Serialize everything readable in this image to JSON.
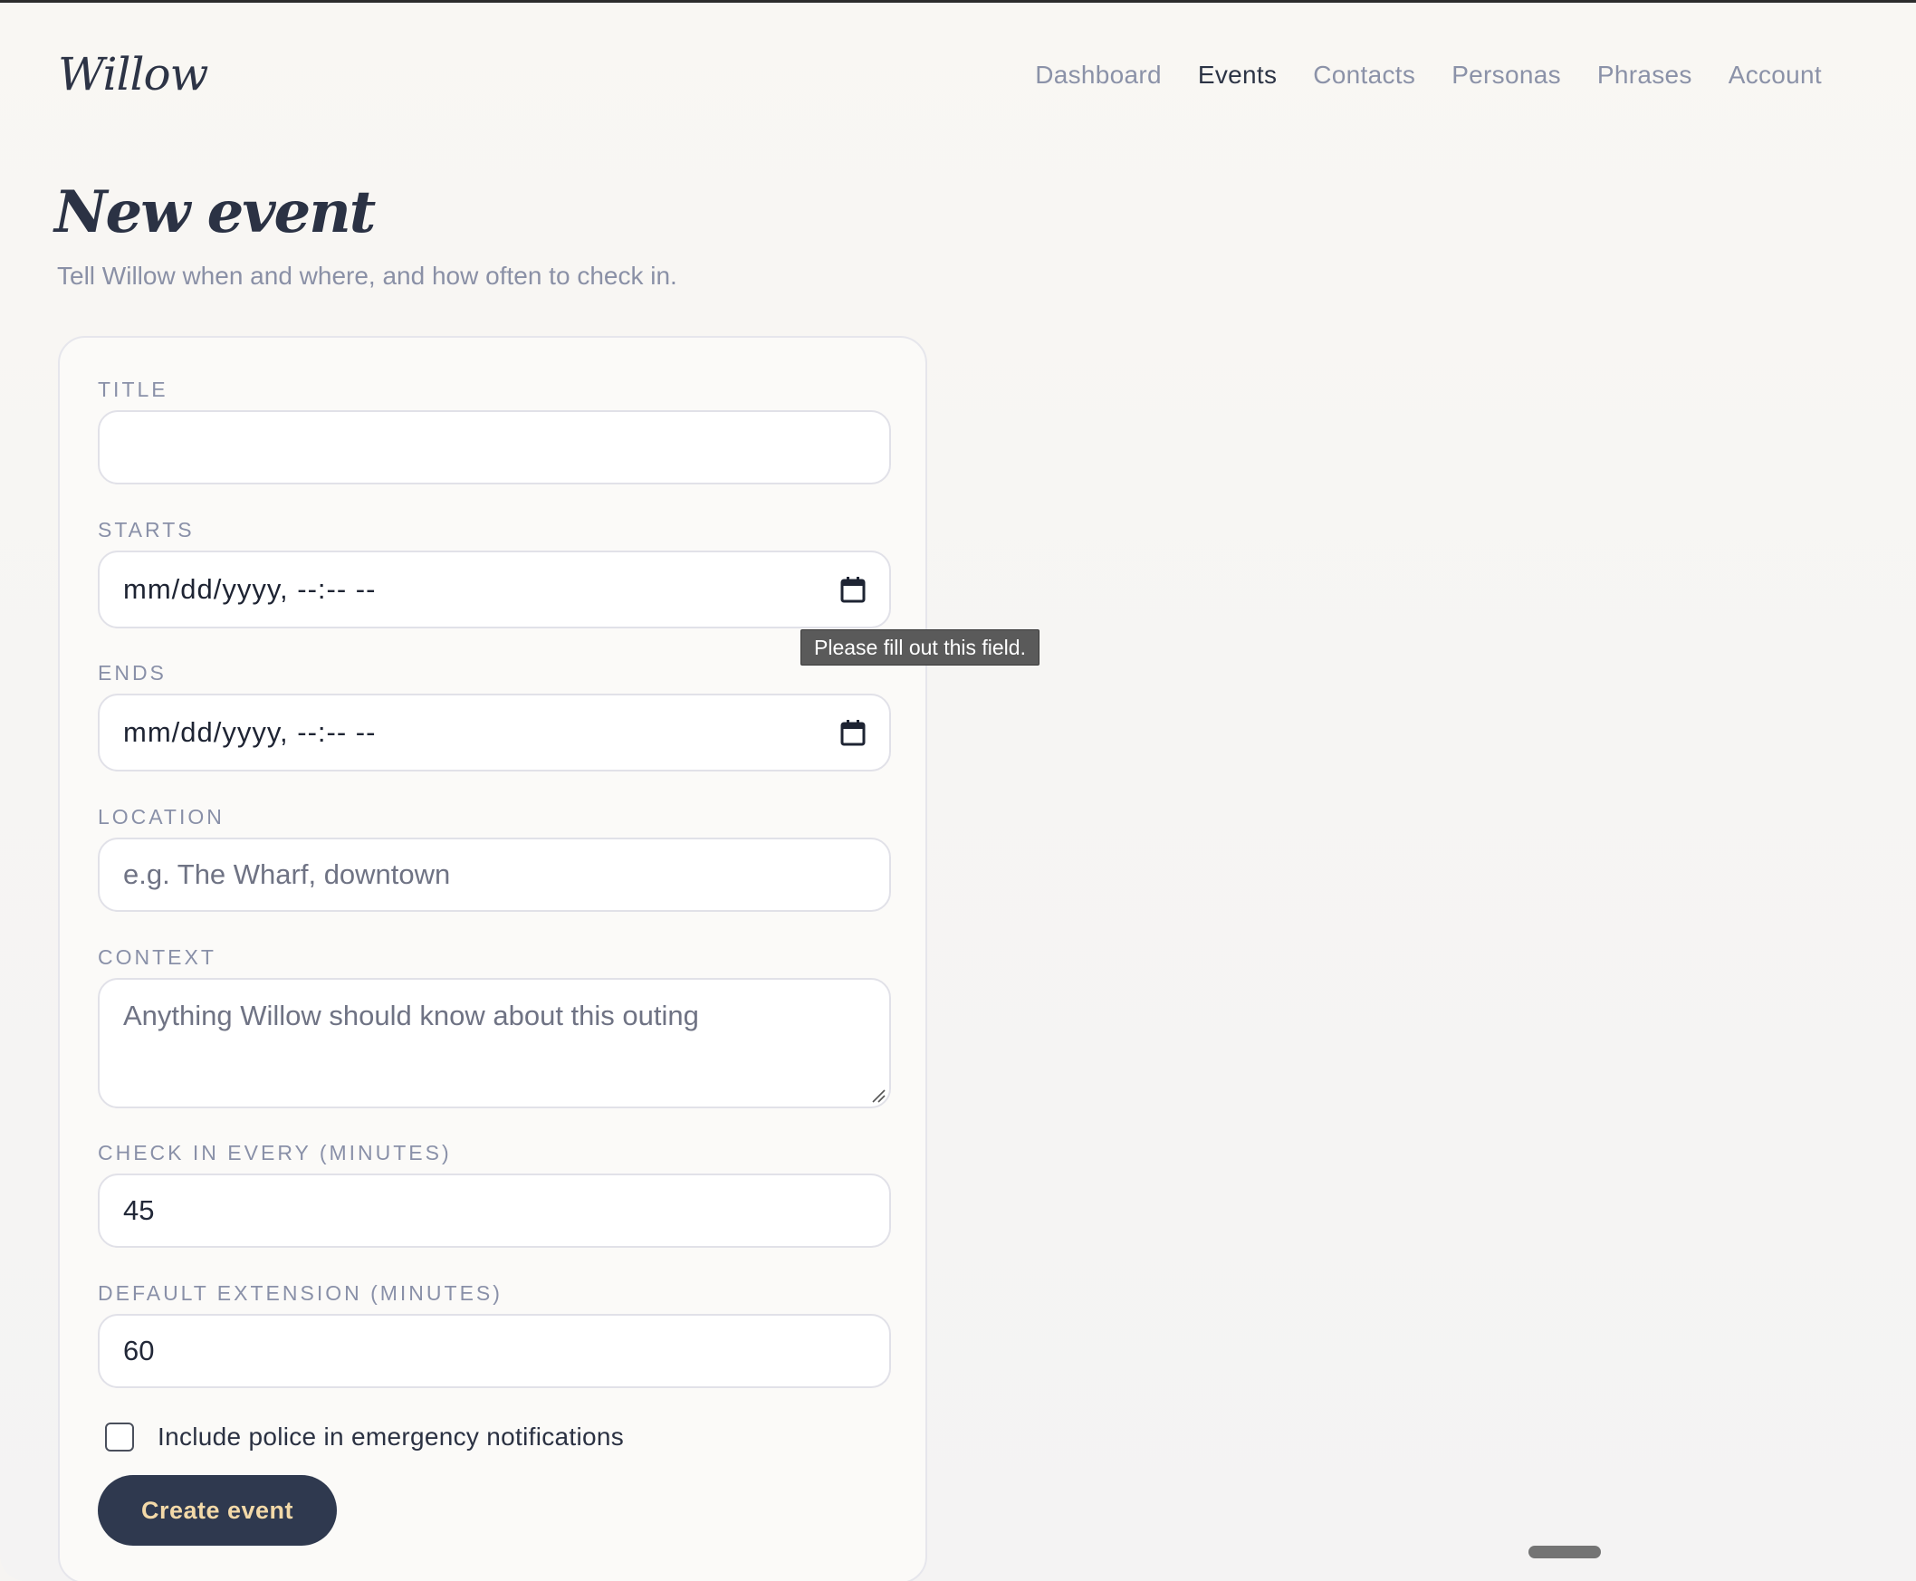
{
  "header": {
    "logo": "Willow",
    "nav": [
      {
        "label": "Dashboard",
        "active": false
      },
      {
        "label": "Events",
        "active": true
      },
      {
        "label": "Contacts",
        "active": false
      },
      {
        "label": "Personas",
        "active": false
      },
      {
        "label": "Phrases",
        "active": false
      },
      {
        "label": "Account",
        "active": false
      }
    ]
  },
  "page": {
    "title": "New event",
    "subtitle": "Tell Willow when and where, and how often to check in."
  },
  "form": {
    "title": {
      "label": "TITLE",
      "value": ""
    },
    "starts": {
      "label": "STARTS",
      "value": "mm/dd/yyyy, --:-- --",
      "icon": "calendar-icon"
    },
    "ends": {
      "label": "ENDS",
      "value": "mm/dd/yyyy, --:-- --",
      "icon": "calendar-icon"
    },
    "location": {
      "label": "LOCATION",
      "placeholder": "e.g. The Wharf, downtown"
    },
    "context": {
      "label": "CONTEXT",
      "placeholder": "Anything Willow should know about this outing"
    },
    "check_in": {
      "label": "CHECK IN EVERY (MINUTES)",
      "value": "45"
    },
    "extension": {
      "label": "DEFAULT EXTENSION (MINUTES)",
      "value": "60"
    },
    "police": {
      "label": "Include police in emergency notifications",
      "checked": false
    },
    "submit_label": "Create event"
  },
  "tooltip": {
    "text": "Please fill out this field."
  },
  "colors": {
    "primary_button": "#2f394f",
    "button_text": "#f3d9a8",
    "nav_inactive": "#8b92a8",
    "nav_active": "#2c3445"
  }
}
